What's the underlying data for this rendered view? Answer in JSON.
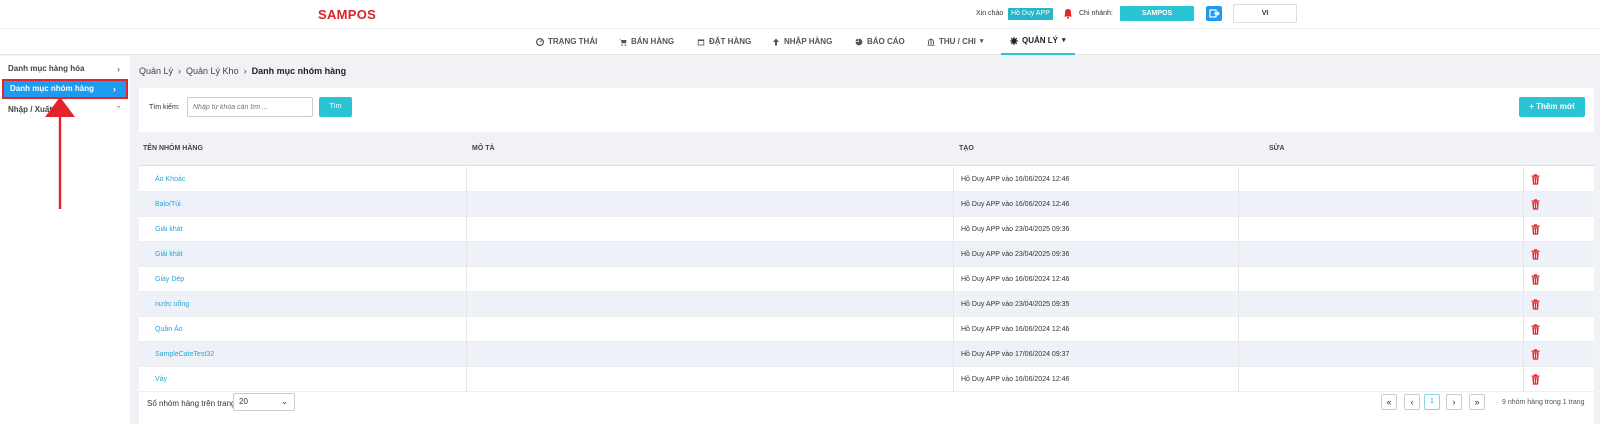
{
  "header": {
    "logo": "SAMPOS",
    "greeting": "Xin chào",
    "user": "Hồ Duy APP",
    "branch_label": "Chi nhánh:",
    "branch": "SAMPOS",
    "language": "VI"
  },
  "nav": [
    {
      "label": "TRẠNG THÁI",
      "icon": "dashboard-icon"
    },
    {
      "label": "BÁN HÀNG",
      "icon": "cart-icon"
    },
    {
      "label": "ĐẶT HÀNG",
      "icon": "calendar-icon"
    },
    {
      "label": "NHẬP HÀNG",
      "icon": "arrow-up-icon"
    },
    {
      "label": "BÁO CÁO",
      "icon": "pie-chart-icon"
    },
    {
      "label": "THU / CHI",
      "icon": "bank-icon"
    },
    {
      "label": "QUẢN LÝ",
      "icon": "gear-icon"
    }
  ],
  "sidebar": {
    "items": [
      {
        "label": "Danh mục hàng hóa"
      },
      {
        "label": "Danh mục nhóm hàng"
      },
      {
        "label": "Nhập / Xuất"
      }
    ]
  },
  "breadcrumb": {
    "items": [
      "Quản Lý",
      "Quản Lý Kho",
      "Danh mục nhóm hàng"
    ]
  },
  "search": {
    "label": "Tìm kiếm:",
    "placeholder": "Nhập từ khóa cần tìm ...",
    "button": "Tìm"
  },
  "add_button": "+ Thêm mới",
  "table": {
    "columns": [
      "TÊN NHÓM HÀNG",
      "MÔ TẢ",
      "TẠO",
      "SỬA"
    ],
    "rows": [
      {
        "name": "Áo Khoác",
        "created": "Hồ Duy APP vào 16/06/2024 12:46"
      },
      {
        "name": "Balo/Túi",
        "created": "Hồ Duy APP vào 16/06/2024 12:46"
      },
      {
        "name": "Giải khát",
        "created": "Hồ Duy APP vào 23/04/2025 09:36"
      },
      {
        "name": "Giải khát",
        "created": "Hồ Duy APP vào 23/04/2025 09:36"
      },
      {
        "name": "Giày Dép",
        "created": "Hồ Duy APP vào 16/06/2024 12:46"
      },
      {
        "name": "nước uống",
        "created": "Hồ Duy APP vào 23/04/2025 09:35"
      },
      {
        "name": "Quần Áo",
        "created": "Hồ Duy APP vào 16/06/2024 12:46"
      },
      {
        "name": "SampleCateTest32",
        "created": "Hồ Duy APP vào 17/06/2024 09:37"
      },
      {
        "name": "Váy",
        "created": "Hồ Duy APP vào 16/06/2024 12:46"
      }
    ]
  },
  "footer": {
    "page_size_label": "Số nhóm hàng trên trang:",
    "page_size": "20",
    "current_page": "1",
    "info": "9 nhóm hàng trong 1 trang"
  },
  "colors": {
    "brand": "#d8232a",
    "accent": "#2bc4d4",
    "active_sidebar": "#1e9bf0",
    "highlight": "#e3242b",
    "link": "#26a5d6"
  }
}
